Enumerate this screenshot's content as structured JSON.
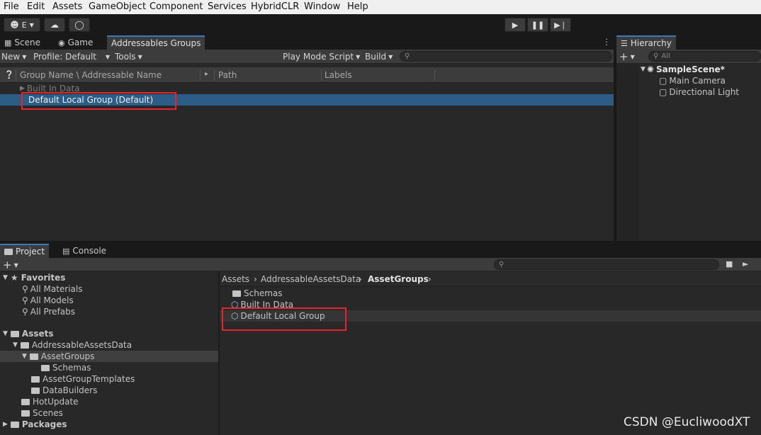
{
  "menu": [
    "File",
    "Edit",
    "Assets",
    "GameObject",
    "Component",
    "Services",
    "HybridCLR",
    "Window",
    "Help"
  ],
  "toolbar": {
    "account_label": "E"
  },
  "scene_tabs": {
    "scene": "Scene",
    "game": "Game",
    "addressables": "Addressables Groups"
  },
  "addr_toolbar": {
    "new": "New",
    "profile": "Profile: Default",
    "tools": "Tools",
    "play_mode": "Play Mode Script",
    "build": "Build"
  },
  "addr_columns": {
    "name": "Group Name \\ Addressable Name",
    "path": "Path",
    "labels": "Labels"
  },
  "addr_groups": [
    {
      "name": "Built In Data"
    },
    {
      "name": "Default Local Group (Default)"
    }
  ],
  "hierarchy": {
    "tab": "Hierarchy",
    "search_placeholder": "All",
    "scene": "SampleScene*",
    "objects": [
      "Main Camera",
      "Directional Light"
    ]
  },
  "bottom_tabs": {
    "project": "Project",
    "console": "Console"
  },
  "project_tree": {
    "favorites": "Favorites",
    "favorite_items": [
      "All Materials",
      "All Models",
      "All Prefabs"
    ],
    "assets": "Assets",
    "addressable_assets_data": "AddressableAssetsData",
    "asset_groups": "AssetGroups",
    "schemas": "Schemas",
    "asset_group_templates": "AssetGroupTemplates",
    "data_builders": "DataBuilders",
    "hot_update": "HotUpdate",
    "scenes": "Scenes",
    "packages": "Packages"
  },
  "breadcrumb": [
    "Assets",
    "AddressableAssetsData",
    "AssetGroups"
  ],
  "project_files": [
    "Schemas",
    "Built In Data",
    "Default Local Group"
  ],
  "watermark": "CSDN @EucliwoodXT"
}
